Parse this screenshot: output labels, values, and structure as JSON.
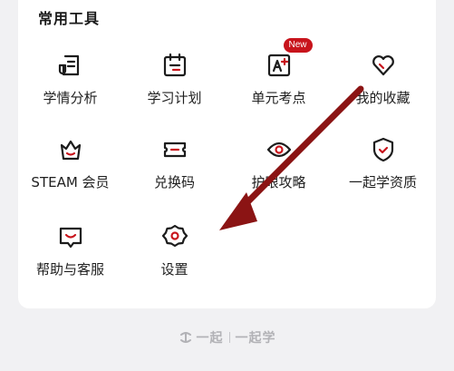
{
  "section": {
    "title": "常用工具"
  },
  "tools": [
    {
      "label": "学情分析",
      "icon": "report-icon"
    },
    {
      "label": "学习计划",
      "icon": "calendar-icon"
    },
    {
      "label": "单元考点",
      "icon": "a-plus-icon",
      "badge": "New"
    },
    {
      "label": "我的收藏",
      "icon": "heart-icon"
    },
    {
      "label": "STEAM 会员",
      "icon": "crown-icon"
    },
    {
      "label": "兑换码",
      "icon": "ticket-icon"
    },
    {
      "label": "护眼攻略",
      "icon": "eye-icon"
    },
    {
      "label": "一起学资质",
      "icon": "shield-check-icon"
    },
    {
      "label": "帮助与客服",
      "icon": "help-chat-icon"
    },
    {
      "label": "设置",
      "icon": "gear-icon"
    }
  ],
  "footer": {
    "brand_a": "一起",
    "brand_b": "一起学"
  },
  "colors": {
    "accent": "#c8141c",
    "annotation_arrow": "#8b1414"
  }
}
